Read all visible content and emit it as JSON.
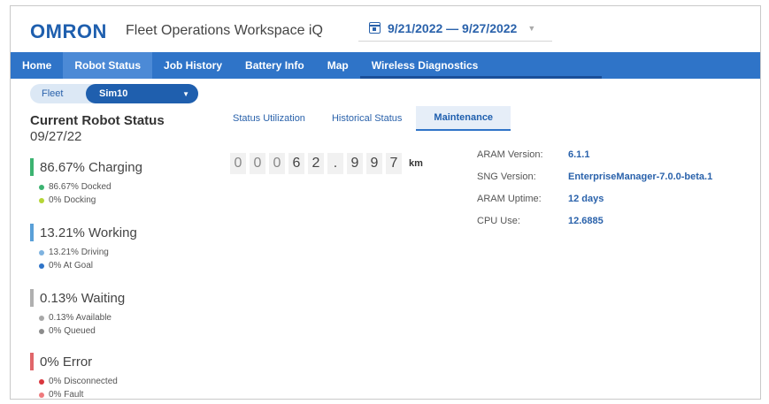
{
  "header": {
    "logo": "OMRON",
    "app_title": "Fleet Operations Workspace iQ",
    "date_range": "9/21/2022 — 9/27/2022",
    "date_icon": "calendar-icon",
    "dropdown_icon": "caret-down-icon"
  },
  "nav": {
    "tabs": [
      {
        "label": "Home"
      },
      {
        "label": "Robot Status"
      },
      {
        "label": "Job History"
      },
      {
        "label": "Battery Info"
      },
      {
        "label": "Map"
      },
      {
        "label": "Wireless Diagnostics"
      }
    ],
    "active_index": 1
  },
  "fleet": {
    "label": "Fleet",
    "value": "Sim10"
  },
  "status": {
    "title": "Current Robot Status",
    "date": "09/27/22",
    "groups": [
      {
        "label": "86.67% Charging",
        "color": "#3cb371",
        "items": [
          {
            "label": "86.67% Docked",
            "color": "#3cb371"
          },
          {
            "label": "0% Docking",
            "color": "#b5d636"
          }
        ]
      },
      {
        "label": "13.21% Working",
        "color": "#5aa0d8",
        "items": [
          {
            "label": "13.21% Driving",
            "color": "#7fb3e0"
          },
          {
            "label": "0% At Goal",
            "color": "#2f74c8"
          }
        ]
      },
      {
        "label": "0.13% Waiting",
        "color": "#b0b0b0",
        "items": [
          {
            "label": "0.13% Available",
            "color": "#a8a8a8"
          },
          {
            "label": "0% Queued",
            "color": "#8c8c8c"
          }
        ]
      },
      {
        "label": "0% Error",
        "color": "#e0666a",
        "items": [
          {
            "label": "0% Disconnected",
            "color": "#d9363e"
          },
          {
            "label": "0% Fault",
            "color": "#ef7a7d"
          }
        ]
      }
    ]
  },
  "content_tabs": [
    {
      "label": "Status Utilization"
    },
    {
      "label": "Historical Status"
    },
    {
      "label": "Maintenance"
    }
  ],
  "content_active_index": 2,
  "odometer": {
    "digits": [
      "0",
      "0",
      "0",
      "6",
      "2",
      ".",
      "9",
      "9",
      "7"
    ],
    "unit": "km"
  },
  "info": [
    {
      "key": "ARAM Version:",
      "value": "6.1.1"
    },
    {
      "key": "SNG Version:",
      "value": "EnterpriseManager-7.0.0-beta.1"
    },
    {
      "key": "ARAM Uptime:",
      "value": "12 days"
    },
    {
      "key": "CPU Use:",
      "value": "12.6885"
    }
  ]
}
